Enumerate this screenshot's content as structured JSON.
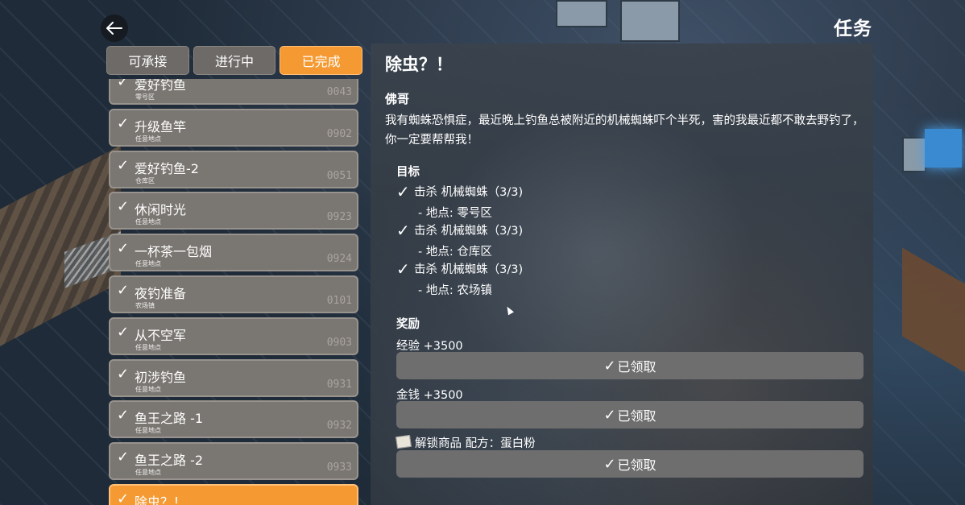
{
  "header": {
    "title": "任务",
    "back_icon": "arrow-left-icon"
  },
  "tabs": [
    {
      "label": "可承接",
      "active": false
    },
    {
      "label": "进行中",
      "active": false
    },
    {
      "label": "已完成",
      "active": true
    }
  ],
  "quests": [
    {
      "name": "爱好钓鱼",
      "location": "零号区",
      "code": "0043"
    },
    {
      "name": "升级鱼竿",
      "location": "任意地点",
      "code": "0902"
    },
    {
      "name": "爱好钓鱼-2",
      "location": "仓库区",
      "code": "0051"
    },
    {
      "name": "休闲时光",
      "location": "任意地点",
      "code": "0923"
    },
    {
      "name": "一杯茶一包烟",
      "location": "任意地点",
      "code": "0924"
    },
    {
      "name": "夜钓准备",
      "location": "农场镇",
      "code": "0101"
    },
    {
      "name": "从不空军",
      "location": "任意地点",
      "code": "0903"
    },
    {
      "name": "初涉钓鱼",
      "location": "任意地点",
      "code": "0931"
    },
    {
      "name": "鱼王之路 -1",
      "location": "任意地点",
      "code": "0932"
    },
    {
      "name": "鱼王之路 -2",
      "location": "任意地点",
      "code": "0933"
    },
    {
      "name": "除虫？！",
      "location": "",
      "code": "",
      "active": true
    }
  ],
  "detail": {
    "title": "除虫？！",
    "giver": "佛哥",
    "description": "我有蜘蛛恐惧症，最近晚上钓鱼总被附近的机械蜘蛛吓个半死，害的我最近都不敢去野钓了，你一定要帮帮我！",
    "objectives_label": "目标",
    "objectives": [
      {
        "text": "击杀 机械蜘蛛（3/3)",
        "location": "- 地点: 零号区"
      },
      {
        "text": "击杀 机械蜘蛛（3/3)",
        "location": "- 地点: 仓库区"
      },
      {
        "text": "击杀 机械蜘蛛（3/3)",
        "location": "- 地点: 农场镇"
      }
    ],
    "rewards_label": "奖励",
    "rewards": [
      {
        "name": "经验 +3500",
        "button": "已领取"
      },
      {
        "name": "金钱 +3500",
        "button": "已领取"
      },
      {
        "name": "解锁商品 配方：蛋白粉",
        "button": "已领取",
        "icon": "recipe-paper-icon"
      }
    ]
  },
  "colors": {
    "accent": "#f59a32",
    "item_bg": "#7a7671",
    "claimed_button": "#6e6e6e"
  }
}
